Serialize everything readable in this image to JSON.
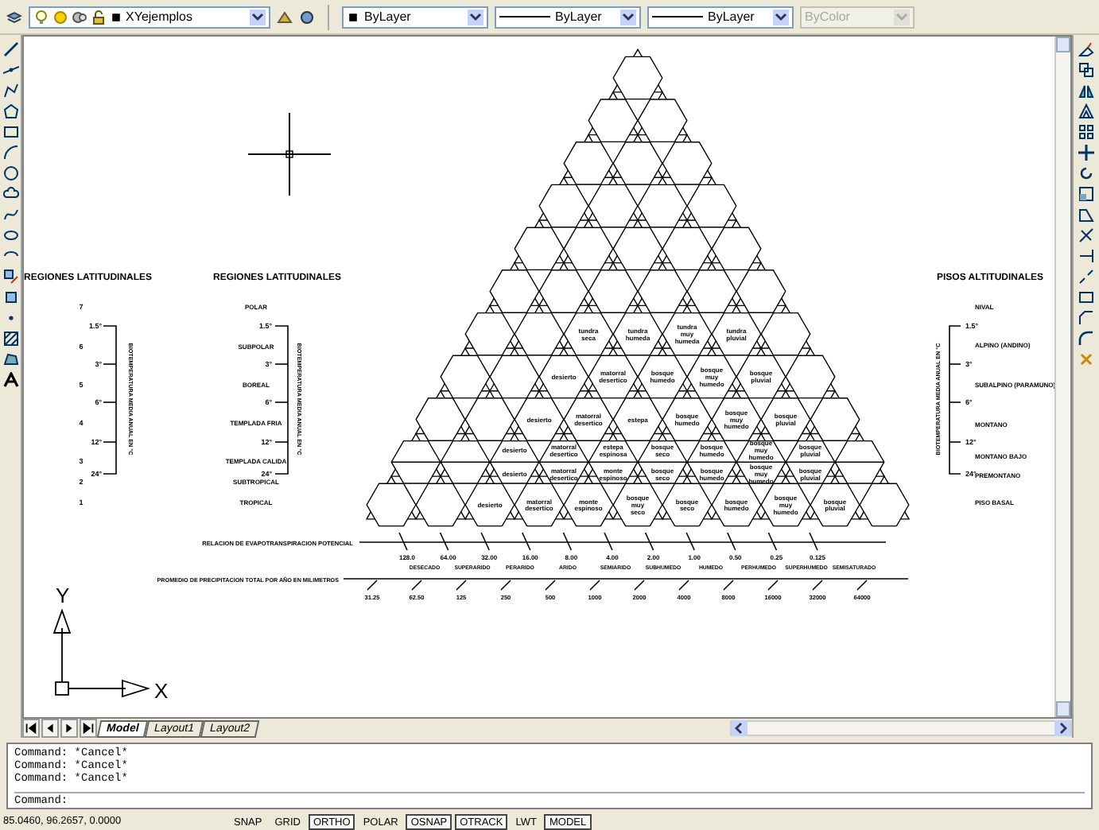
{
  "toolbar": {
    "layer": "XYejemplos",
    "color_control": "ByLayer",
    "linetype": "ByLayer",
    "lineweight": "ByLayer",
    "plot_style": "ByColor"
  },
  "drawing": {
    "left_scale": {
      "title": "REGIONES LATITUDINALES",
      "numbers": [
        "7",
        "6",
        "5",
        "4",
        "3",
        "2",
        "1"
      ],
      "temperatures": [
        "1.5°",
        "3°",
        "6°",
        "12°",
        "24°"
      ],
      "bracket_label": "BIOTEMPERATURA MEDIA ANUAL EN °C"
    },
    "middle_scale": {
      "title": "REGIONES LATITUDINALES",
      "regions": [
        "POLAR",
        "SUBPOLAR",
        "BOREAL",
        "TEMPLADA FRIA",
        "TEMPLADA CALIDA",
        "SUBTROPICAL",
        "TROPICAL"
      ],
      "temperatures": [
        "1.5°",
        "3°",
        "6°",
        "12°",
        "24°"
      ],
      "bracket_label": "BIOTEMPERATURA MEDIA ANUAL EN °C"
    },
    "right_scale": {
      "title": "PISOS ALTITUDINALES",
      "floors": [
        "NIVAL",
        "ALPINO (ANDINO)",
        "SUBALPINO (PARAMUNO)",
        "MONTANO",
        "MONTANO BAJO",
        "PREMONTANO",
        "PISO BASAL"
      ],
      "temperatures": [
        "1.5°",
        "3°",
        "6°",
        "12°",
        "24°"
      ],
      "bracket_label": "BIOTEMPERATURA MEDIA ANUAL EN °C"
    },
    "life_zone_rows": [
      {
        "zones": [
          "tundra seca",
          "tundra humeda",
          "tundra muy humeda",
          "tundra pluvial"
        ]
      },
      {
        "zones": [
          "desierto",
          "matorral desertico",
          "bosque humedo",
          "bosque muy humedo",
          "bosque pluvial"
        ]
      },
      {
        "zones": [
          "desierto",
          "matorral desertico",
          "estepa",
          "bosque humedo",
          "bosque muy humedo",
          "bosque pluvial"
        ]
      },
      {
        "zones": [
          "desierto",
          "matorral desertico",
          "estepa espinosa",
          "bosque seco",
          "bosque humedo",
          "bosque muy humedo",
          "bosque pluvial"
        ],
        "lower_zones": [
          "desierto",
          "matorral desertico",
          "monte espinoso",
          "bosque seco",
          "bosque humedo",
          "bosque muy humedo",
          "bosque pluvial"
        ]
      },
      {
        "zones": [
          "desierto",
          "matorral desertico",
          "monte espinoso",
          "bosque muy seco",
          "bosque seco",
          "bosque humedo",
          "bosque muy humedo",
          "bosque pluvial"
        ]
      }
    ],
    "ratio_axis": {
      "title": "RELACION DE EVAPOTRANSPIRACION POTENCIAL",
      "values": [
        "128.0",
        "64.00",
        "32.00",
        "16.00",
        "8.00",
        "4.00",
        "2.00",
        "1.00",
        "0.50",
        "0.25",
        "0.125"
      ]
    },
    "humidity_provinces": [
      "DESECADO",
      "SUPERARIDO",
      "PERARIDO",
      "ARIDO",
      "SEMIARIDO",
      "SUBHUMEDO",
      "HUMEDO",
      "PERHUMEDO",
      "SUPERHUMEDO",
      "SEMISATURADO"
    ],
    "precipitation_axis": {
      "title": "PROMEDIO DE PRECIPITACION TOTAL POR AÑO EN MILIMETROS",
      "values": [
        "31.25",
        "62.50",
        "125",
        "250",
        "500",
        "1000",
        "2000",
        "4000",
        "8000",
        "16000",
        "32000",
        "64000"
      ]
    },
    "ucs": {
      "x": "X",
      "y": "Y"
    }
  },
  "layout_tabs": [
    {
      "label": "Model",
      "selected": true
    },
    {
      "label": "Layout1",
      "selected": false
    },
    {
      "label": "Layout2",
      "selected": false
    }
  ],
  "command_history": [
    "Command: *Cancel*",
    "Command: *Cancel*",
    "Command: *Cancel*"
  ],
  "command_prompt": "Command:",
  "status_bar": {
    "coordinates": "85.0460, 96.2657, 0.0000",
    "buttons": [
      {
        "label": "SNAP",
        "on": false
      },
      {
        "label": "GRID",
        "on": false
      },
      {
        "label": "ORTHO",
        "on": true
      },
      {
        "label": "POLAR",
        "on": false
      },
      {
        "label": "OSNAP",
        "on": true
      },
      {
        "label": "OTRACK",
        "on": true
      },
      {
        "label": "LWT",
        "on": false
      },
      {
        "label": "MODEL",
        "on": true
      }
    ]
  }
}
